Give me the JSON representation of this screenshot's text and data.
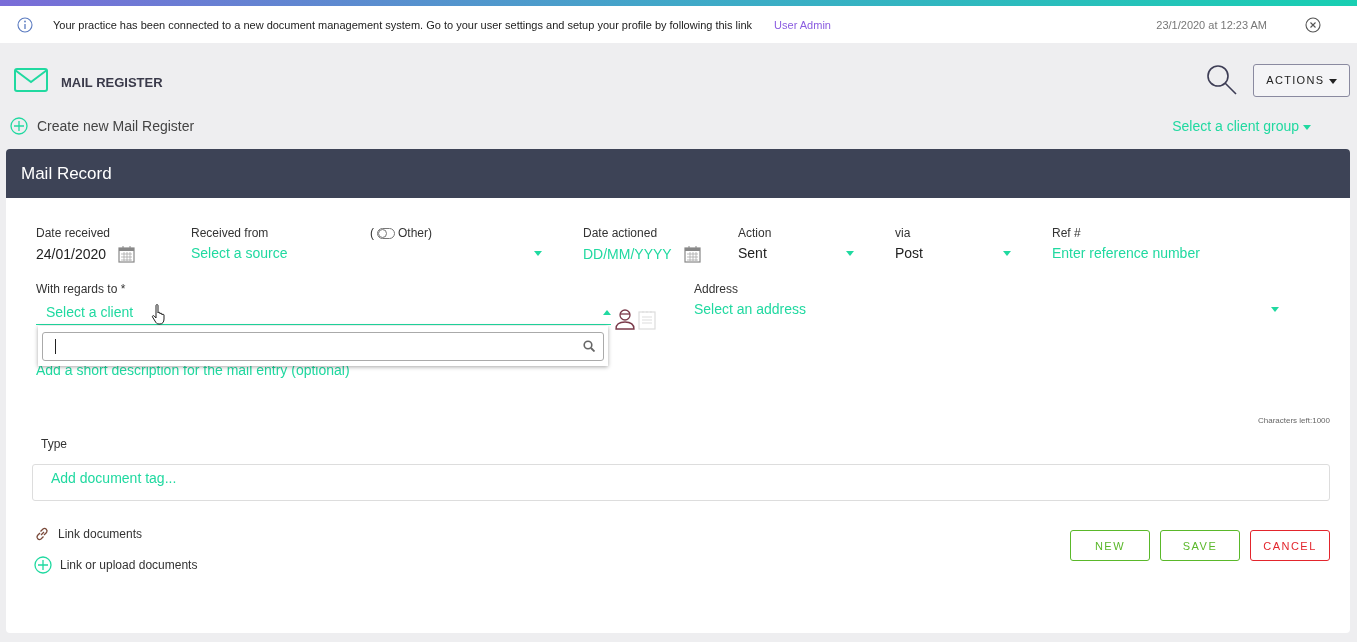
{
  "notice": {
    "message": "Your practice has been connected to a new document management system. Go to your user settings and setup your profile by following this link",
    "link": "User Admin",
    "timestamp": "23/1/2020 at 12:23 AM"
  },
  "header": {
    "title": "MAIL REGISTER",
    "actions_button": "ACTIONS"
  },
  "create_link": "Create new Mail Register",
  "client_group": {
    "placeholder": "Select a client group"
  },
  "card": {
    "title": "Mail Record"
  },
  "date_received": {
    "label": "Date received",
    "value": "24/01/2020"
  },
  "received_from": {
    "label": "Received from",
    "placeholder": "Select a source",
    "other_toggle": {
      "prefix": "(",
      "label": "Other)",
      "on": false
    }
  },
  "date_actioned": {
    "label": "Date actioned",
    "placeholder": "DD/MM/YYYY"
  },
  "action": {
    "label": "Action",
    "value": "Sent"
  },
  "via": {
    "label": "via",
    "value": "Post"
  },
  "ref": {
    "label": "Ref #",
    "placeholder": "Enter reference number"
  },
  "with_regards_to": {
    "label": "With regards to *",
    "placeholder": "Select a client",
    "expanded": true
  },
  "address": {
    "label": "Address",
    "placeholder": "Select an address"
  },
  "description": {
    "placeholder": "Add a short description for the mail entry (optional)",
    "chars_left": "Characters left:1000"
  },
  "type": {
    "label": "Type",
    "placeholder": "Add document tag..."
  },
  "links": [
    {
      "kind": "link",
      "label": "Link documents"
    },
    {
      "kind": "add",
      "label": "Link or upload documents"
    }
  ],
  "buttons": [
    {
      "kind": "ok",
      "label": "NEW"
    },
    {
      "kind": "ok",
      "label": "SAVE"
    },
    {
      "kind": "danger",
      "label": "CANCEL"
    }
  ]
}
